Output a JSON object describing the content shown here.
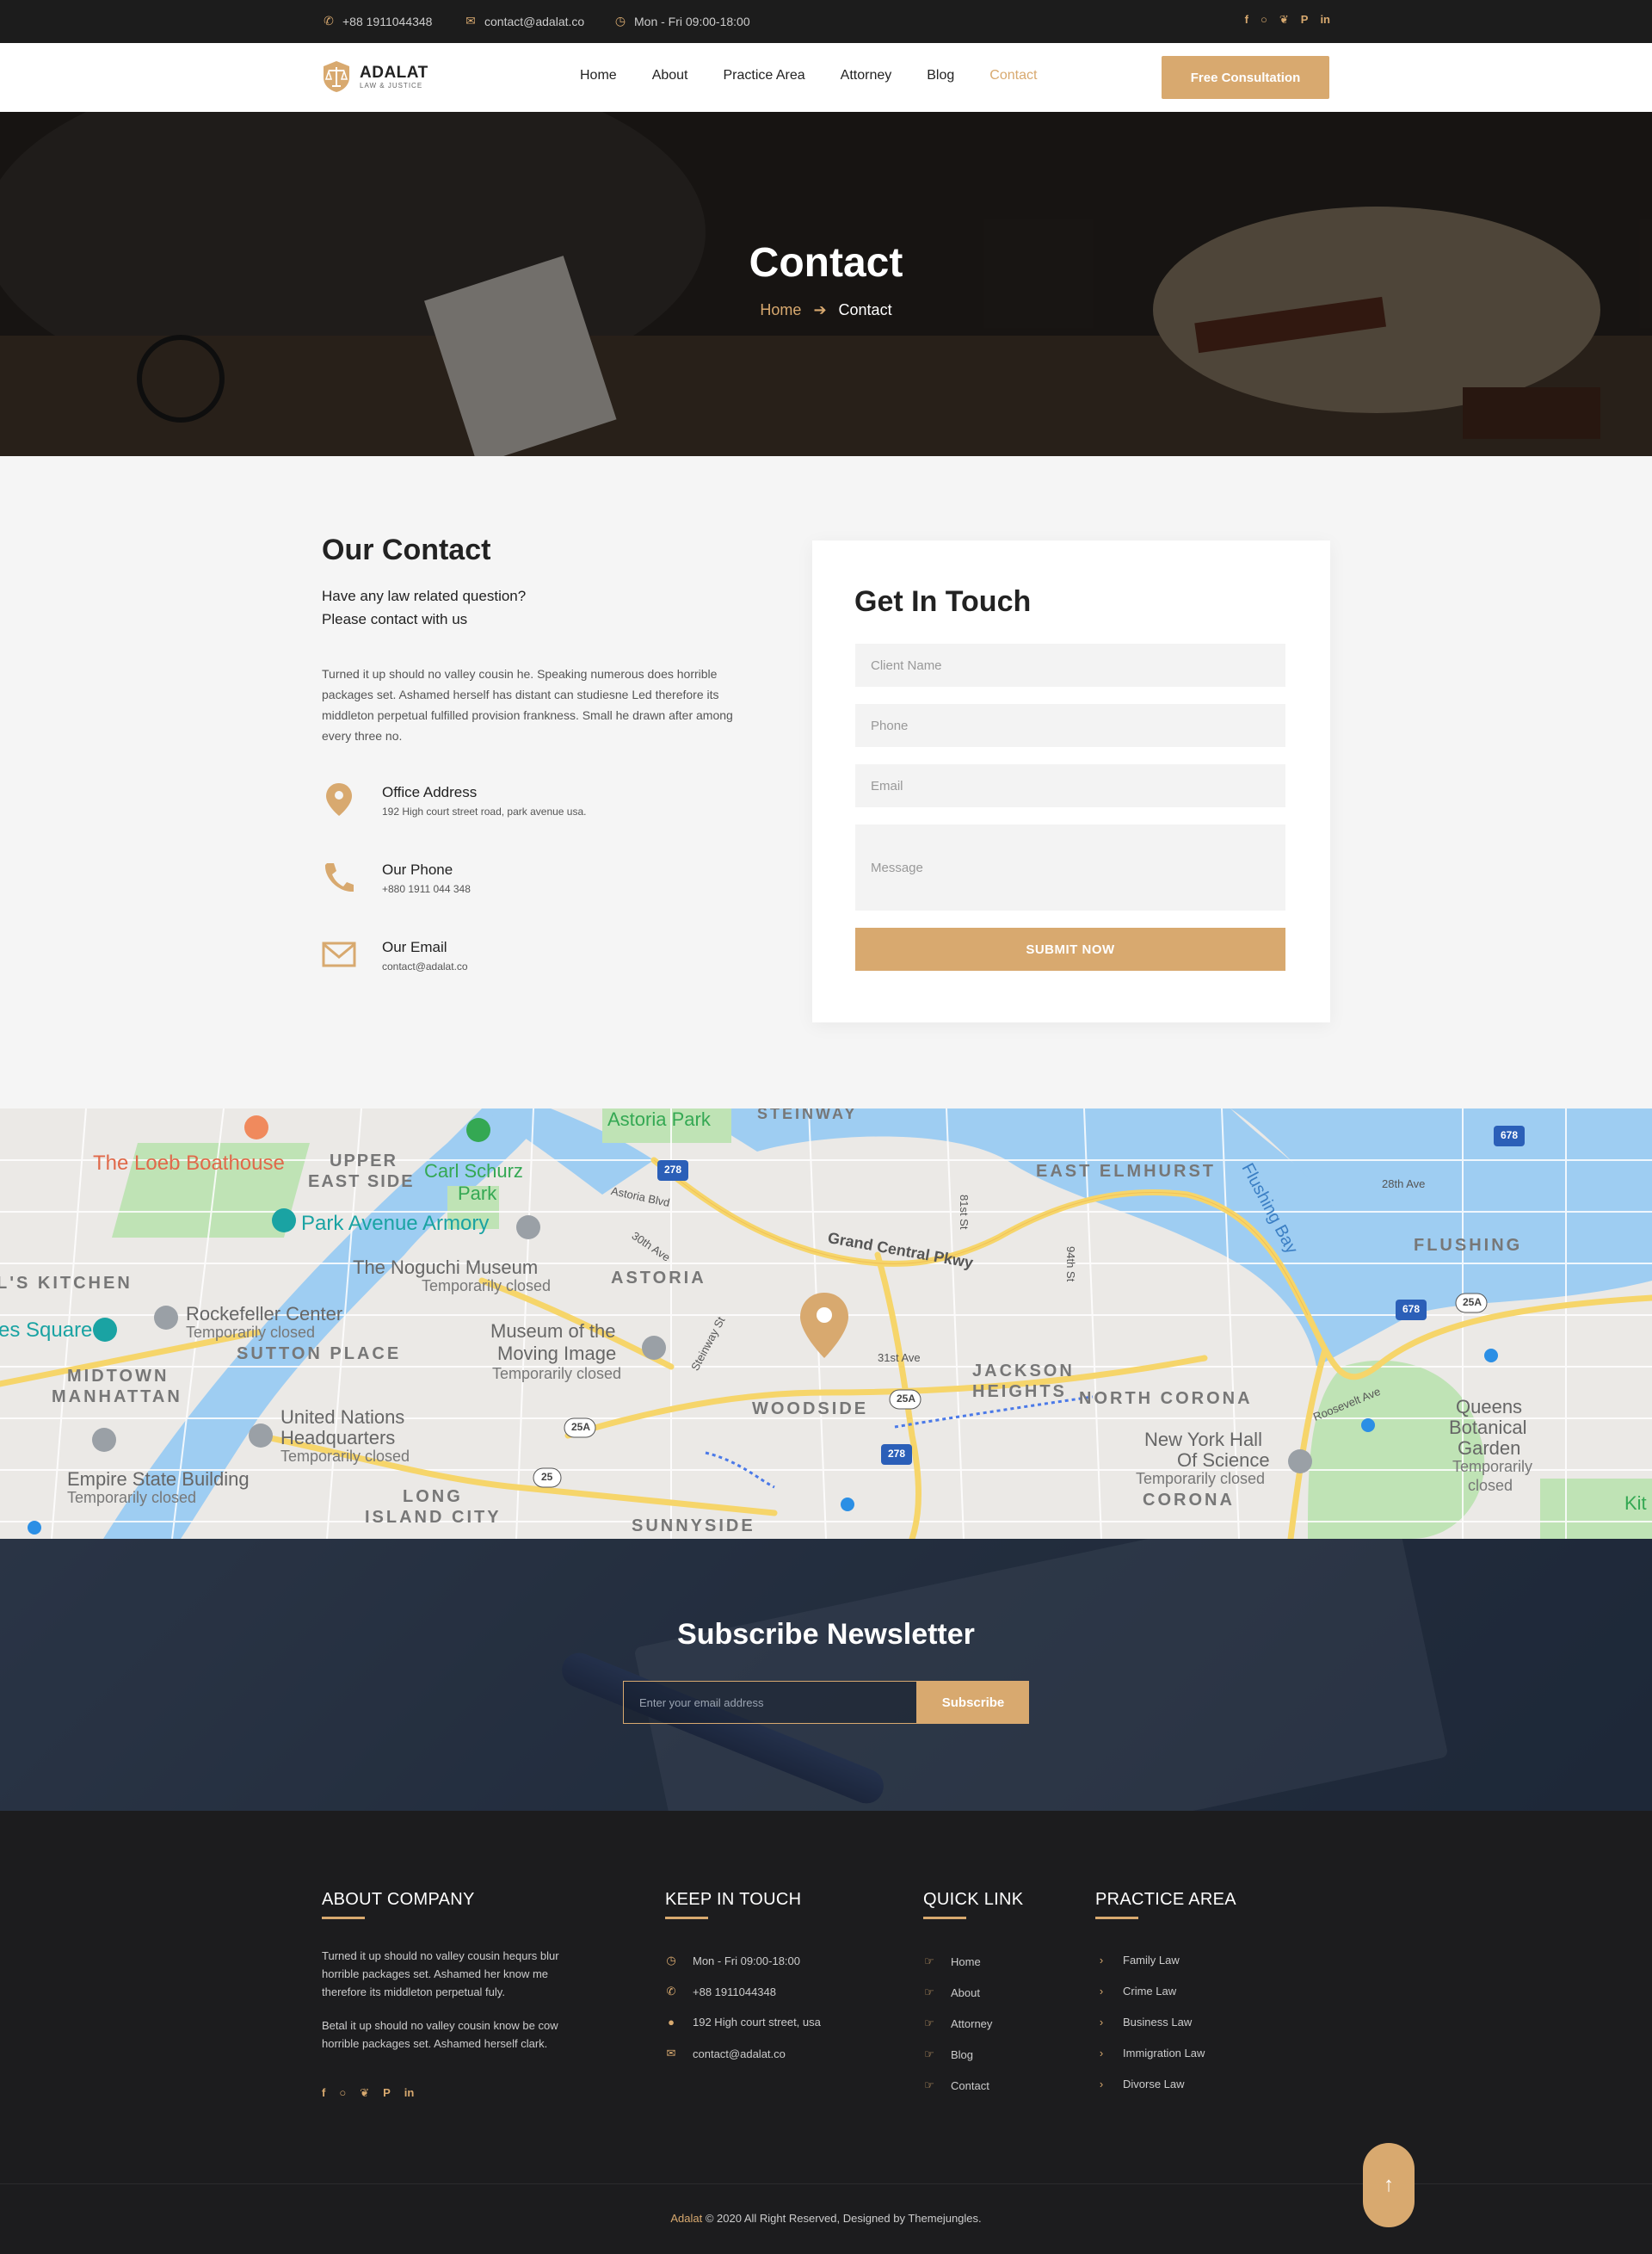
{
  "topbar": {
    "phone": "+88 1911044348",
    "email": "contact@adalat.co",
    "hours": "Mon - Fri 09:00-18:00",
    "social": [
      "f",
      "ig",
      "tw",
      "p",
      "in"
    ]
  },
  "header": {
    "logo_name": "ADALAT",
    "logo_tag": "LAW & JUSTICE",
    "nav": [
      "Home",
      "About",
      "Practice Area",
      "Attorney",
      "Blog",
      "Contact"
    ],
    "active_nav": "Contact",
    "cta": "Free Consultation"
  },
  "hero": {
    "title": "Contact",
    "crumb_home": "Home",
    "crumb_current": "Contact"
  },
  "contact": {
    "title": "Our Contact",
    "sub_line1": "Have any law related question?",
    "sub_line2": "Please contact with us",
    "desc": "Turned it up should no valley cousin he. Speaking numerous does horrible packages set. Ashamed herself has distant can studiesne Led therefore its middleton perpetual fulfilled provision frankness. Small he drawn after among every three no.",
    "items": [
      {
        "title": "Office Address",
        "value": "192 High court street road, park avenue usa.",
        "icon": "map-pin-icon"
      },
      {
        "title": "Our Phone",
        "value": "+880 1911 044 348",
        "icon": "phone-icon"
      },
      {
        "title": "Our Email",
        "value": "contact@adalat.co",
        "icon": "envelope-icon"
      }
    ]
  },
  "form": {
    "title": "Get In Touch",
    "name_placeholder": "Client Name",
    "phone_placeholder": "Phone",
    "email_placeholder": "Email",
    "message_placeholder": "Message",
    "submit": "SUBMIT NOW"
  },
  "map": {
    "labels": {
      "astoria_park": "Astoria Park",
      "steinway": "STEINWAY",
      "loeb": "The Loeb Boathouse",
      "upper_east_1": "UPPER",
      "upper_east_2": "EAST SIDE",
      "schurz_1": "Carl Schurz",
      "schurz_2": "Park",
      "east_elmhurst": "EAST ELMHURST",
      "flushing_bay": "Flushing Bay",
      "park_ave": "Park Avenue Armory",
      "noguchi_1": "The Noguchi Museum",
      "noguchi_2": "Temporarily closed",
      "astoria": "ASTORIA",
      "grand_central": "Grand Central Pkwy",
      "flushing": "FLUSHING",
      "kitchen": "L'S KITCHEN",
      "rockefeller_1": "Rockefeller Center",
      "rockefeller_2": "Temporarily closed",
      "sutton": "SUTTON PLACE",
      "moving_1": "Museum of the",
      "moving_2": "Moving Image",
      "moving_3": "Temporarily closed",
      "times_sq": "es Square",
      "jackson_1": "JACKSON",
      "jackson_2": "HEIGHTS",
      "north_corona": "NORTH CORONA",
      "midtown_1": "MIDTOWN",
      "midtown_2": "MANHATTAN",
      "woodside": "WOODSIDE",
      "queens_1": "Queens",
      "queens_2": "Botanical",
      "queens_3": "Garden",
      "queens_4": "Temporarily",
      "queens_5": "closed",
      "un_1": "United Nations",
      "un_2": "Headquarters",
      "un_3": "Temporarily closed",
      "nyhall_1": "New York Hall",
      "nyhall_2": "Of Science",
      "nyhall_3": "Temporarily closed",
      "empire_1": "Empire State Building",
      "empire_2": "Temporarily closed",
      "lic_1": "LONG",
      "lic_2": "ISLAND CITY",
      "corona": "CORONA",
      "sunnyside": "SUNNYSIDE",
      "hw_278a": "278",
      "hw_278b": "278",
      "hw_678a": "678",
      "hw_678b": "678",
      "hw_25a_1": "25A",
      "hw_25a_2": "25A",
      "hw_25a_3": "25A",
      "hw_25": "25",
      "st_28th": "28th Ave",
      "st_31st": "31st Ave",
      "st_astoria_blvd": "Astoria Blvd",
      "st_30th": "30th Ave",
      "st_steinway": "Steinway St",
      "st_94th": "94th St",
      "st_roosevelt": "Roosevelt Ave",
      "st_81st": "81st St",
      "kit": "Kit"
    }
  },
  "newsletter": {
    "title": "Subscribe Newsletter",
    "placeholder": "Enter your email address",
    "button": "Subscribe"
  },
  "footer": {
    "about_title": "ABOUT COMPANY",
    "about_p1": "Turned it up should no valley cousin hequrs blur horrible packages set. Ashamed her know me therefore its middleton perpetual fuly.",
    "about_p2": "Betal it up should no valley cousin know be cow horrible packages set. Ashamed herself clark.",
    "keep_title": "KEEP IN TOUCH",
    "keep_items": [
      "Mon - Fri 09:00-18:00",
      "+88 1911044348",
      "192 High court street, usa",
      "contact@adalat.co"
    ],
    "quick_title": "QUICK LINK",
    "quick_items": [
      "Home",
      "About",
      "Attorney",
      "Blog",
      "Contact"
    ],
    "practice_title": "PRACTICE AREA",
    "practice_items": [
      "Family Law",
      "Crime Law",
      "Business Law",
      "Immigration Law",
      "Divorse Law"
    ],
    "copy_brand": "Adalat",
    "copy_rest": " © 2020 All Right Reserved, Designed by Themejungles."
  },
  "colors": {
    "accent": "#d8a96f",
    "dark": "#1c1c1c",
    "navy": "#2a3445"
  }
}
